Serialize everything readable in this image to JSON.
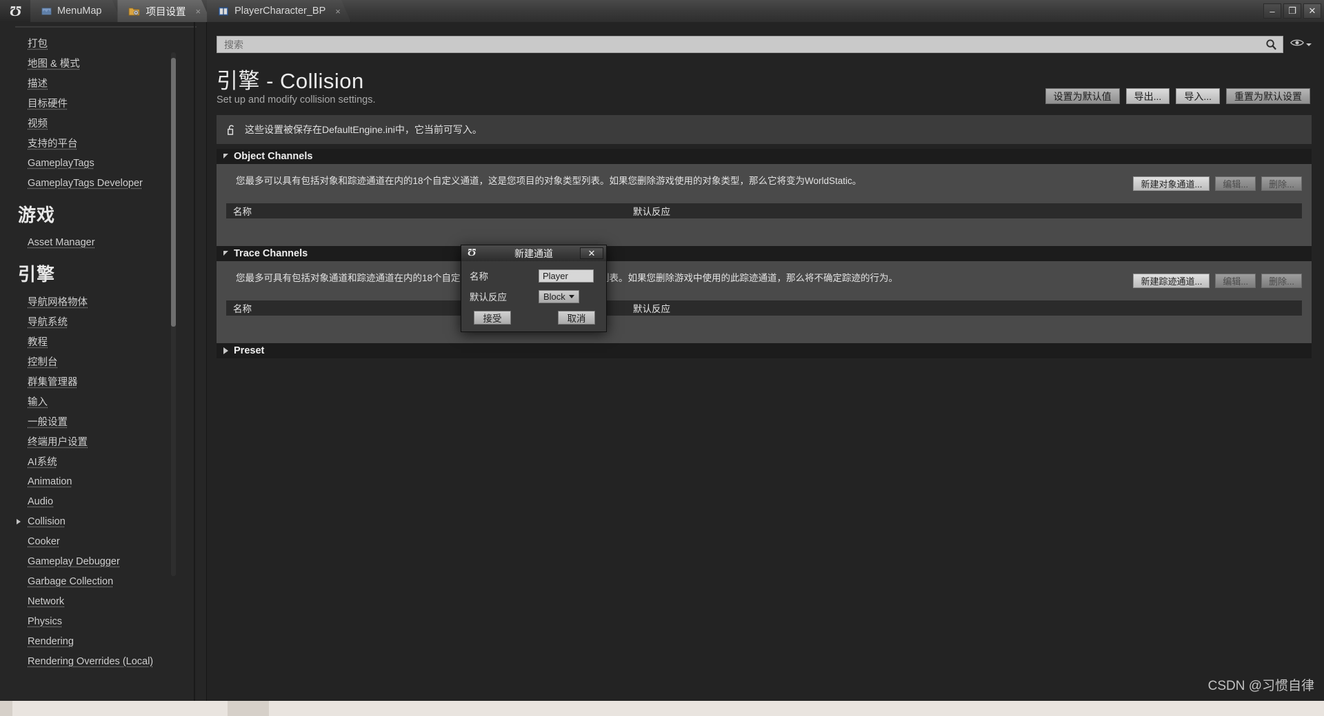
{
  "window": {
    "logo": "Ʊ",
    "minimize": "–",
    "maximize": "❐",
    "close": "✕"
  },
  "tabs": [
    {
      "label": "MenuMap",
      "icon": "map-icon",
      "active": false,
      "close": ""
    },
    {
      "label": "项目设置",
      "icon": "project-settings-icon",
      "active": true,
      "close": "×"
    },
    {
      "label": "PlayerCharacter_BP",
      "icon": "blueprint-icon",
      "active": false,
      "close": "×"
    }
  ],
  "sidebar": {
    "groups": [
      {
        "title": "",
        "items": [
          {
            "label": "打包",
            "expandable": false
          },
          {
            "label": "地图 & 模式",
            "expandable": false
          },
          {
            "label": "描述",
            "expandable": false
          },
          {
            "label": "目标硬件",
            "expandable": false
          },
          {
            "label": "视频",
            "expandable": false
          },
          {
            "label": "支持的平台",
            "expandable": false
          },
          {
            "label": "GameplayTags",
            "expandable": false
          },
          {
            "label": "GameplayTags Developer",
            "expandable": false
          }
        ]
      },
      {
        "title": "游戏",
        "items": [
          {
            "label": "Asset Manager",
            "expandable": false
          }
        ]
      },
      {
        "title": "引擎",
        "items": [
          {
            "label": "导航网格物体",
            "expandable": false
          },
          {
            "label": "导航系统",
            "expandable": false
          },
          {
            "label": "教程",
            "expandable": false
          },
          {
            "label": "控制台",
            "expandable": false
          },
          {
            "label": "群集管理器",
            "expandable": false
          },
          {
            "label": "输入",
            "expandable": false
          },
          {
            "label": "一般设置",
            "expandable": false
          },
          {
            "label": "终端用户设置",
            "expandable": false
          },
          {
            "label": "AI系统",
            "expandable": false
          },
          {
            "label": "Animation",
            "expandable": false
          },
          {
            "label": "Audio",
            "expandable": false
          },
          {
            "label": "Collision",
            "expandable": true
          },
          {
            "label": "Cooker",
            "expandable": false
          },
          {
            "label": "Gameplay Debugger",
            "expandable": false
          },
          {
            "label": "Garbage Collection",
            "expandable": false
          },
          {
            "label": "Network",
            "expandable": false
          },
          {
            "label": "Physics",
            "expandable": false
          },
          {
            "label": "Rendering",
            "expandable": false
          },
          {
            "label": "Rendering Overrides (Local)",
            "expandable": false
          }
        ]
      }
    ]
  },
  "search": {
    "placeholder": "搜索",
    "value": "",
    "icon": "search-icon",
    "view_options_icon": "eye-icon"
  },
  "page": {
    "title": "引擎 - Collision",
    "subtitle": "Set up and modify collision settings.",
    "info_text": "这些设置被保存在DefaultEngine.ini中，它当前可写入。",
    "info_icon": "unlock-icon"
  },
  "toolbar": {
    "set_as_default": "设置为默认值",
    "export": "导出...",
    "import": "导入...",
    "reset_to_default": "重置为默认设置"
  },
  "sections": [
    {
      "id": "object-channels",
      "title": "Object Channels",
      "expanded": true,
      "description": "您最多可以具有包括对象和踪迹通道在内的18个自定义通道，这是您项目的对象类型列表。如果您删除游戏使用的对象类型，那么它将变为WorldStatic。",
      "actions": {
        "new": "新建对象通道...",
        "edit": "编辑...",
        "delete": "删除..."
      },
      "columns": [
        "名称",
        "默认反应"
      ],
      "rows": []
    },
    {
      "id": "trace-channels",
      "title": "Trace Channels",
      "expanded": true,
      "description": "您最多可具有包括对象通道和踪迹通道在内的18个自定义通道。这是您的项目的踪迹通道列表。如果您删除游戏中使用的此踪迹通道，那么将不确定踪迹的行为。",
      "actions": {
        "new": "新建踪迹通道...",
        "edit": "编辑...",
        "delete": "删除..."
      },
      "columns": [
        "名称",
        "默认反应"
      ],
      "rows": []
    }
  ],
  "preset_section": {
    "title": "Preset",
    "expanded": false
  },
  "modal": {
    "title": "新建通道",
    "close_label": "✕",
    "name_label": "名称",
    "name_value": "Player",
    "response_label": "默认反应",
    "response_value": "Block",
    "accept": "接受",
    "cancel": "取消"
  },
  "watermark": "CSDN @习惯自律"
}
